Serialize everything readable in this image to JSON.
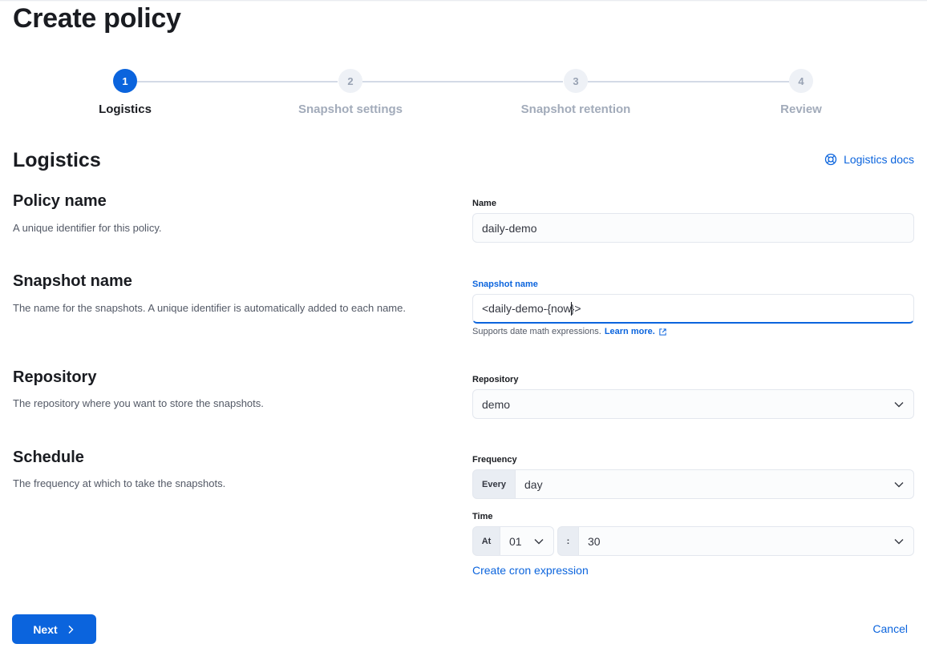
{
  "page": {
    "title": "Create policy"
  },
  "stepper": {
    "steps": [
      {
        "number": "1",
        "label": "Logistics",
        "state": "active"
      },
      {
        "number": "2",
        "label": "Snapshot settings",
        "state": "pending"
      },
      {
        "number": "3",
        "label": "Snapshot retention",
        "state": "pending"
      },
      {
        "number": "4",
        "label": "Review",
        "state": "pending"
      }
    ]
  },
  "section": {
    "title": "Logistics",
    "docs_link": "Logistics docs"
  },
  "policy_name": {
    "title": "Policy name",
    "description": "A unique identifier for this policy.",
    "label": "Name",
    "value": "daily-demo"
  },
  "snapshot_name": {
    "title": "Snapshot name",
    "description": "The name for the snapshots. A unique identifier is automatically added to each name.",
    "label": "Snapshot name",
    "value_before_caret": "<daily-demo-{now",
    "value_after_caret": "}>",
    "help_text": "Supports date math expressions.",
    "help_link": "Learn more."
  },
  "repository": {
    "title": "Repository",
    "description": "The repository where you want to store the snapshots.",
    "label": "Repository",
    "value": "demo"
  },
  "schedule": {
    "title": "Schedule",
    "description": "The frequency at which to take the snapshots.",
    "frequency_label": "Frequency",
    "frequency_prepend": "Every",
    "frequency_value": "day",
    "time_label": "Time",
    "time_prepend": "At",
    "hour_value": "01",
    "minute_prepend": ":",
    "minute_value": "30",
    "cron_link": "Create cron expression"
  },
  "actions": {
    "next": "Next",
    "cancel": "Cancel"
  },
  "colors": {
    "primary": "#0b64dd",
    "text": "#1a1c21",
    "subdued": "#535966",
    "border": "#e3e7ee"
  }
}
